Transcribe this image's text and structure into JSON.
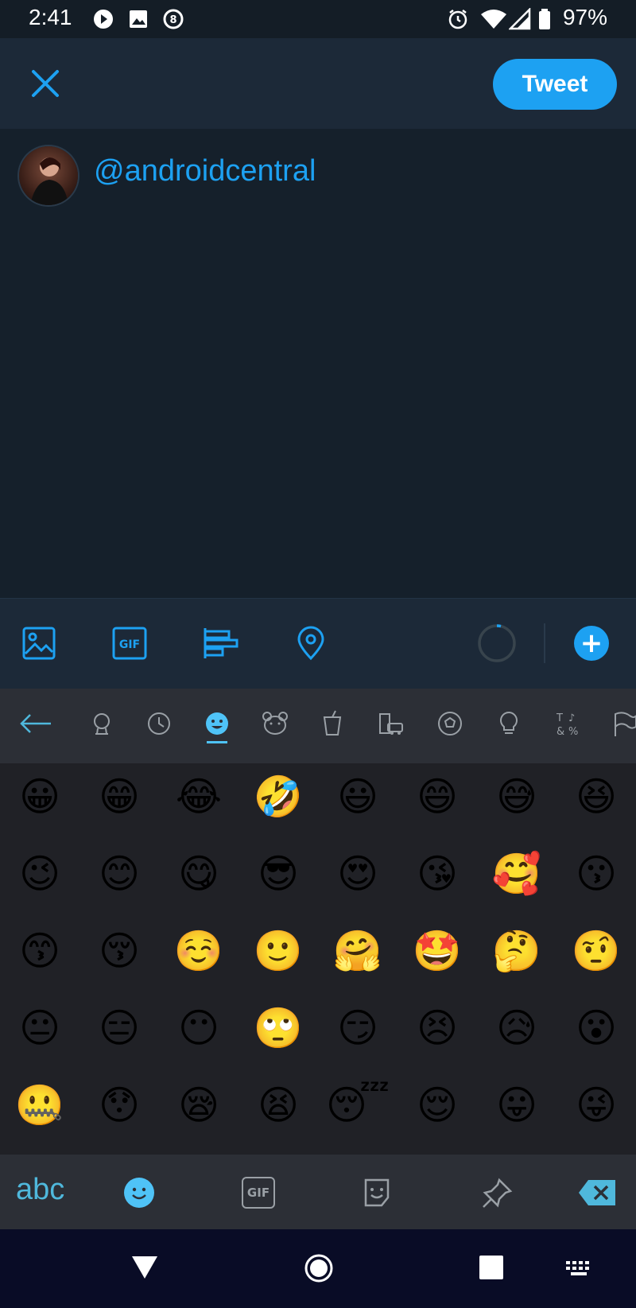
{
  "status_bar": {
    "time": "2:41",
    "battery": "97%"
  },
  "header": {
    "tweet_label": "Tweet"
  },
  "compose": {
    "text": "@androidcentral"
  },
  "toolbar": {
    "icons": [
      "image-icon",
      "gif-icon",
      "poll-icon",
      "location-icon"
    ]
  },
  "keyboard": {
    "category_tabs": [
      "back-arrow",
      "recent-globe",
      "recent-clock",
      "smileys",
      "animals",
      "food",
      "travel",
      "activities",
      "objects",
      "symbols",
      "flags"
    ],
    "active_tab": "smileys",
    "emojis": [
      [
        "😀",
        "😁",
        "😂",
        "🤣",
        "😃",
        "😄",
        "😅",
        "😆"
      ],
      [
        "😉",
        "😊",
        "😋",
        "😎",
        "😍",
        "😘",
        "🥰",
        "😗"
      ],
      [
        "😙",
        "😚",
        "☺️",
        "🙂",
        "🤗",
        "🤩",
        "🤔",
        "🤨"
      ],
      [
        "😐",
        "😑",
        "😶",
        "🙄",
        "😏",
        "😣",
        "😥",
        "😮"
      ],
      [
        "🤐",
        "😯",
        "😪",
        "😫",
        "😴",
        "😌",
        "😛",
        "😜"
      ]
    ],
    "bottom": {
      "abc_label": "abc",
      "gif_label": "GIF"
    },
    "accent": "#4fc3f7"
  },
  "colors": {
    "brand": "#1da1f2",
    "background": "#15202b"
  }
}
